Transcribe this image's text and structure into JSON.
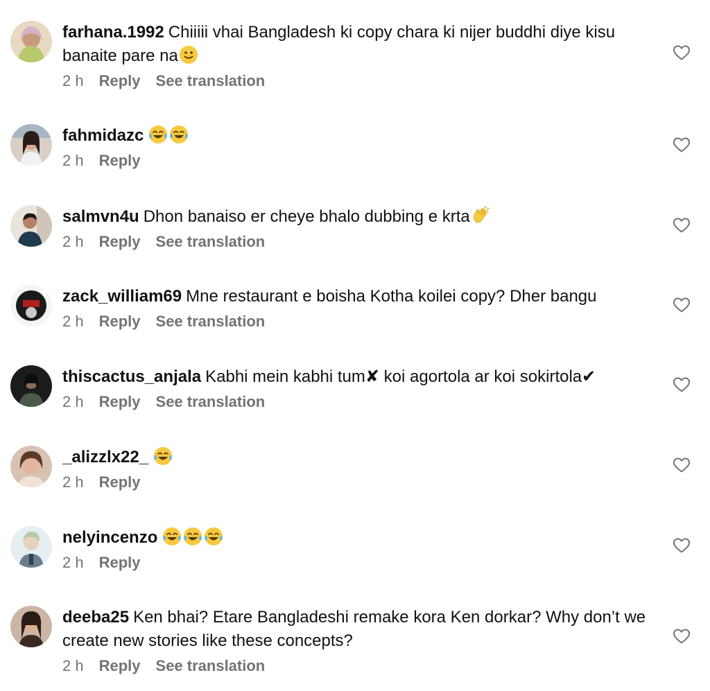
{
  "labels": {
    "reply": "Reply",
    "see_translation": "See translation"
  },
  "comments": [
    {
      "username": "farhana.1992",
      "text": "Chiiiii vhai Bangladesh ki copy chara ki nijer buddhi diye kisu banaite pare na",
      "emojis": [
        "slightly-smiling-face"
      ],
      "time": "2 h",
      "translation": true
    },
    {
      "username": "fahmidazc",
      "text": "",
      "emojis": [
        "tears-of-joy",
        "tears-of-joy"
      ],
      "time": "2 h",
      "translation": false
    },
    {
      "username": "salmvn4u",
      "text": "Dhon banaiso er cheye bhalo dubbing e krta",
      "emojis": [
        "clapping-hands"
      ],
      "time": "2 h",
      "translation": true
    },
    {
      "username": "zack_william69",
      "text": "Mne restaurant e boisha Kotha koilei copy? Dher bangu",
      "emojis": [],
      "time": "2 h",
      "translation": true
    },
    {
      "username": "thiscactus_anjala",
      "text": "Kabhi mein kabhi tum✘ koi agortola ar koi sokirtola✔",
      "emojis": [],
      "time": "2 h",
      "translation": true
    },
    {
      "username": "_alizzlx22_",
      "text": "",
      "emojis": [
        "tears-of-joy"
      ],
      "time": "2 h",
      "translation": false
    },
    {
      "username": "nelyincenzo",
      "text": "",
      "emojis": [
        "tears-of-joy",
        "tears-of-joy",
        "tears-of-joy"
      ],
      "time": "2 h",
      "translation": false
    },
    {
      "username": "deeba25",
      "text": "Ken bhai? Etare Bangladeshi remake kora Ken dorkar? Why don’t we create new stories like these concepts?",
      "emojis": [],
      "time": "2 h",
      "translation": true
    }
  ],
  "icons": {
    "like": "heart-outline-icon"
  },
  "colors": {
    "text": "#111111",
    "meta": "#737373",
    "background": "#ffffff"
  }
}
